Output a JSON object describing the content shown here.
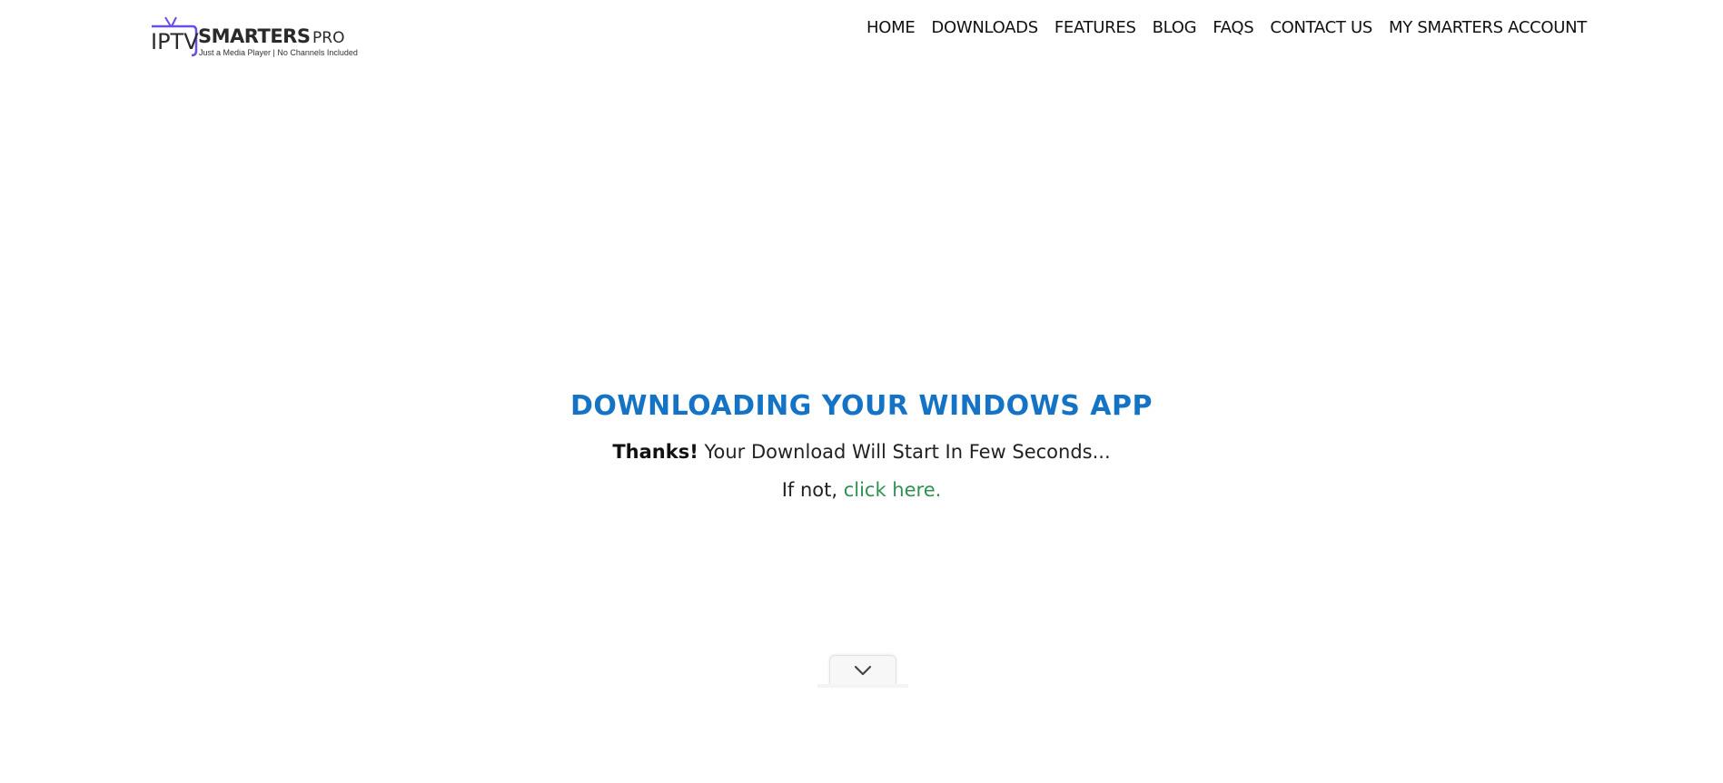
{
  "logo": {
    "iptv": "IPTV",
    "smarters": "SMARTERS",
    "pro": "PRO",
    "tagline": "Just a Media Player | No Channels Included",
    "accent_color": "#6b4ee6"
  },
  "nav": {
    "items": [
      {
        "label": "HOME"
      },
      {
        "label": "DOWNLOADS"
      },
      {
        "label": "FEATURES"
      },
      {
        "label": "BLOG"
      },
      {
        "label": "FAQS"
      },
      {
        "label": "CONTACT US"
      },
      {
        "label": "MY SMARTERS ACCOUNT"
      }
    ]
  },
  "main": {
    "title": "DOWNLOADING YOUR WINDOWS APP",
    "thanks_bold": "Thanks!",
    "thanks_rest": " Your Download Will Start In Few Seconds...",
    "if_not": "If not, ",
    "click_here": "click here.",
    "title_color": "#1473c5",
    "link_color": "#2e9150"
  },
  "scroll": {
    "icon": "chevron-down-icon"
  }
}
